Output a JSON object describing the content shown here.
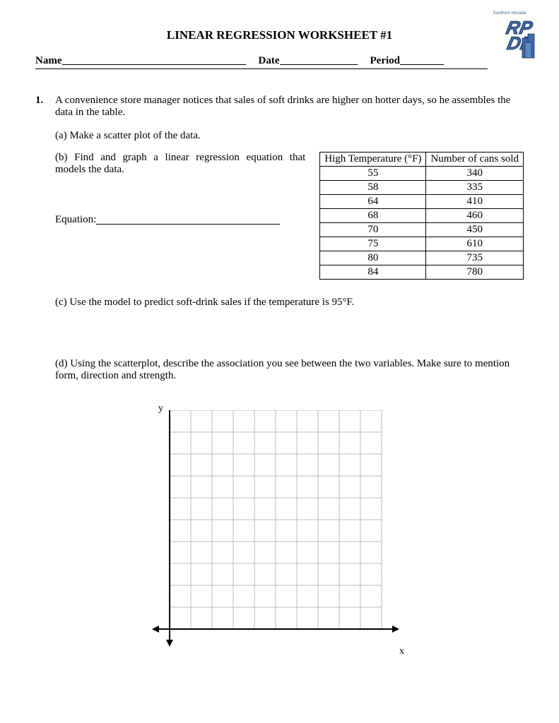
{
  "title": "LINEAR REGRESSION WORKSHEET #1",
  "header": {
    "name_label": "Name",
    "date_label": "Date",
    "period_label": "Period"
  },
  "logo": {
    "line1": "RP",
    "line2": "DP",
    "caption": "Southern Nevada"
  },
  "q1": {
    "num": "1.",
    "intro": "A convenience store manager notices that sales of soft drinks are higher on hotter days, so he assembles the data in the table.",
    "a": "(a)  Make a scatter plot of the data.",
    "b": "(b) Find and graph a linear regression equation that models the data.",
    "equation_label": "Equation:",
    "c": "(c)  Use the model to predict soft-drink sales if the temperature is 95°F.",
    "d": "(d)  Using the scatterplot, describe the association you see between the two variables.  Make sure to mention form, direction and strength."
  },
  "chart_data": {
    "type": "table",
    "headers": [
      "High Temperature (°F)",
      "Number of cans sold"
    ],
    "rows": [
      [
        55,
        340
      ],
      [
        58,
        335
      ],
      [
        64,
        410
      ],
      [
        68,
        460
      ],
      [
        70,
        450
      ],
      [
        75,
        610
      ],
      [
        80,
        735
      ],
      [
        84,
        780
      ]
    ]
  },
  "grid": {
    "y_label": "y",
    "x_label": "x"
  }
}
